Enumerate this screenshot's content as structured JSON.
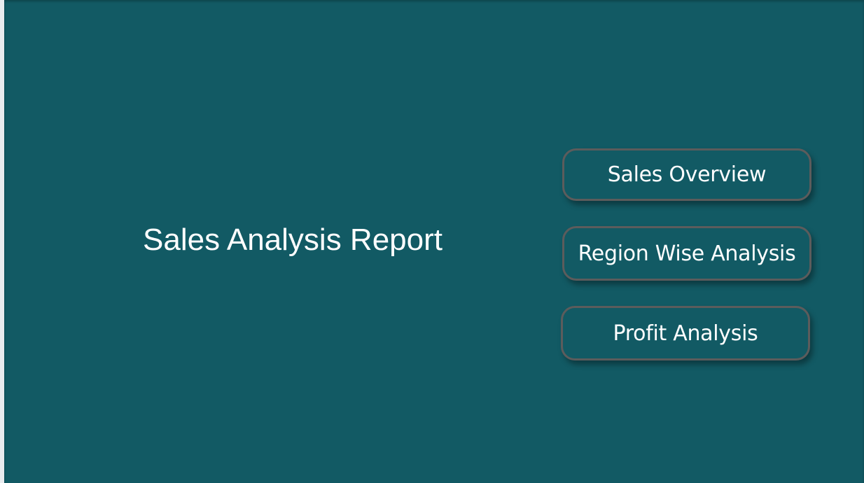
{
  "report": {
    "title": "Sales Analysis Report"
  },
  "navigation": {
    "buttons": [
      {
        "label": "Sales Overview"
      },
      {
        "label": "Region Wise Analysis"
      },
      {
        "label": "Profit Analysis"
      }
    ]
  },
  "colors": {
    "background": "#125a64",
    "button_border": "#5c5c5c",
    "text": "#ffffff"
  }
}
